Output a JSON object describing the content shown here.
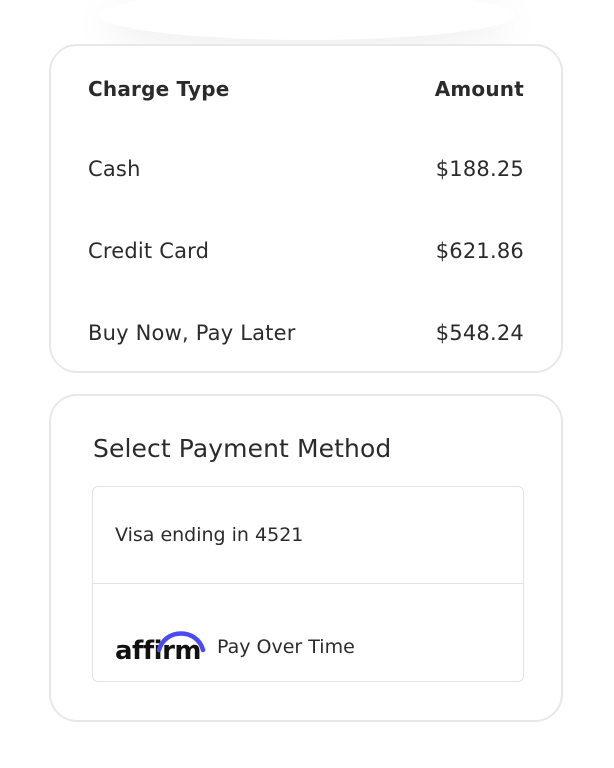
{
  "charges": {
    "header": {
      "type_label": "Charge Type",
      "amount_label": "Amount"
    },
    "rows": [
      {
        "type": "Cash",
        "amount": "$188.25"
      },
      {
        "type": "Credit Card",
        "amount": "$621.86"
      },
      {
        "type": "Buy Now, Pay Later",
        "amount": "$548.24"
      }
    ]
  },
  "payment": {
    "title": "Select Payment Method",
    "options": [
      {
        "label": "Visa ending in 4521"
      },
      {
        "logo": "affirm",
        "label": "Pay Over Time",
        "logo_icon": "affirm-arc-icon",
        "brand_color": "#4a4af4"
      }
    ]
  }
}
